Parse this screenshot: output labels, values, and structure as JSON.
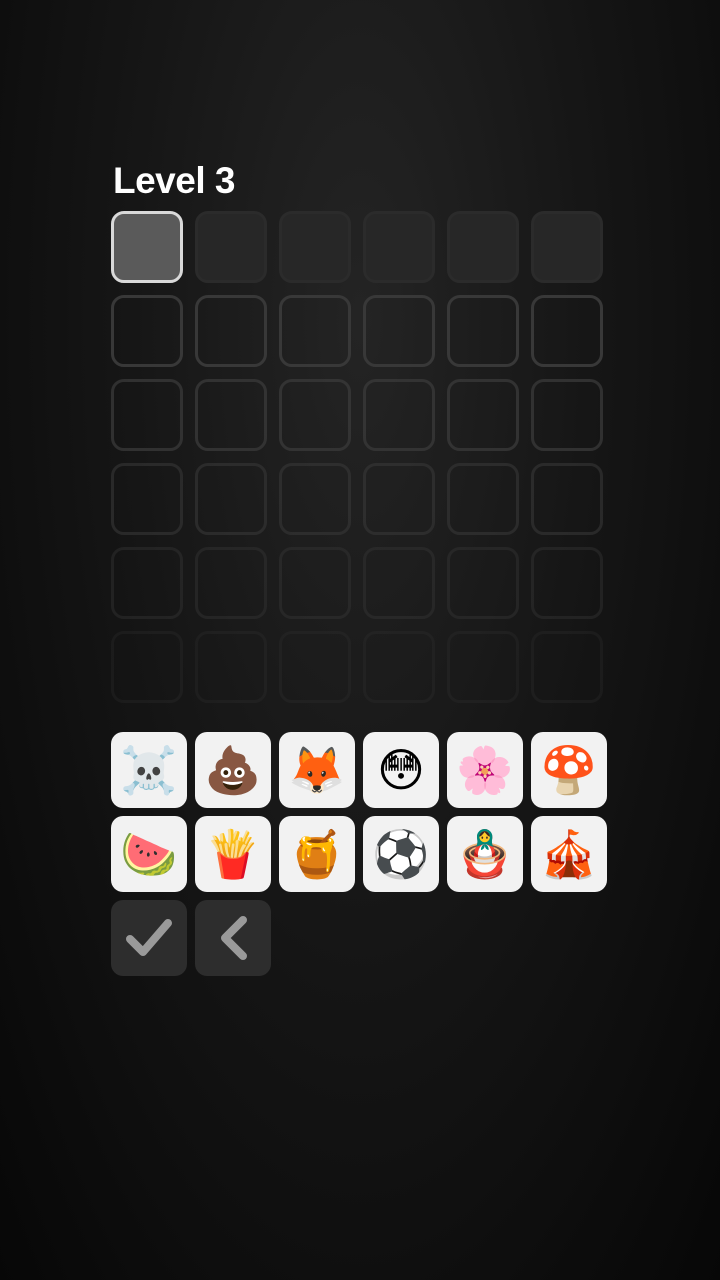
{
  "header": {
    "level_label": "Level 3"
  },
  "board": {
    "rows": 6,
    "columns": 6,
    "active_row": 0,
    "active_cell": 0
  },
  "keyboard": {
    "keys": [
      {
        "emoji": "☠️",
        "name": "skull-crossbones"
      },
      {
        "emoji": "💩",
        "name": "pile-of-poo"
      },
      {
        "emoji": "🦊",
        "name": "fox"
      },
      {
        "emoji": "😳",
        "name": "flushed-face"
      },
      {
        "emoji": "🌸",
        "name": "cherry-blossom"
      },
      {
        "emoji": "🍄",
        "name": "mushroom"
      },
      {
        "emoji": "🍉",
        "name": "watermelon"
      },
      {
        "emoji": "🍟",
        "name": "french-fries"
      },
      {
        "emoji": "🍯",
        "name": "honey-pot"
      },
      {
        "emoji": "⚽",
        "name": "soccer-ball"
      },
      {
        "emoji": "🪆",
        "name": "nesting-dolls"
      },
      {
        "emoji": "🎪",
        "name": "circus-tent"
      }
    ],
    "submit_icon": "checkmark-icon",
    "back_icon": "chevron-left-icon"
  },
  "colors": {
    "key_background": "#f2f2f2",
    "control_background": "#2d2d2d",
    "active_cell_border": "#d9d9d9"
  }
}
